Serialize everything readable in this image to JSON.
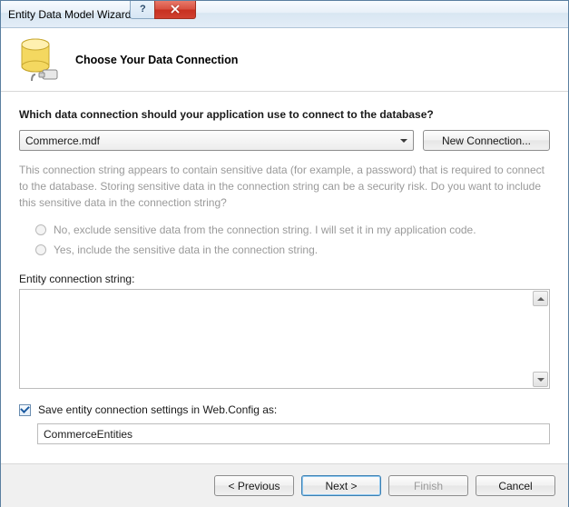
{
  "titlebar": {
    "title": "Entity Data Model Wizard"
  },
  "header": {
    "heading": "Choose Your Data Connection"
  },
  "content": {
    "question": "Which data connection should your application use to connect to the database?",
    "selected_connection": "Commerce.mdf",
    "new_connection_label": "New Connection...",
    "security_text": "This connection string appears to contain sensitive data (for example, a password) that is required to connect to the database. Storing sensitive data in the connection string can be a security risk. Do you want to include this sensitive data in the connection string?",
    "radio_no": "No, exclude sensitive data from the connection string. I will set it in my application code.",
    "radio_yes": "Yes, include the sensitive data in the connection string.",
    "conn_string_label": "Entity connection string:",
    "conn_string_value": "",
    "save_checkbox_label": "Save entity connection settings in Web.Config as:",
    "save_checkbox_checked": true,
    "entity_name": "CommerceEntities"
  },
  "footer": {
    "previous": "< Previous",
    "next": "Next >",
    "finish": "Finish",
    "cancel": "Cancel"
  }
}
